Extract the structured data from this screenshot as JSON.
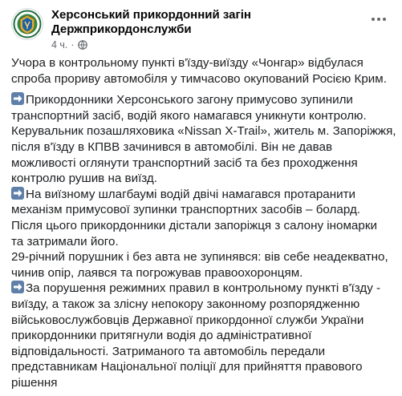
{
  "post": {
    "page_name_line1": "Херсонський прикордонний загін",
    "page_name_line2": "Держприкордонслужби",
    "time": "4 ч.",
    "separator": "·",
    "privacy_icon": "globe-icon",
    "more_icon": "more-options-icon",
    "paragraphs": [
      {
        "lines": [
          "Учора в контрольному пункті в'їзду-виїзду «Чонгар» відбулася",
          "спроба прориву автомобіля у тимчасово окупований Росією Крим."
        ]
      },
      {
        "lines": [
          "Прикордонники Херсонського загону примусово зупинили",
          "транспортний засіб, водій якого намагався уникнути контролю.",
          "Керувальник позашляховика «Nissan X-Trail», житель м. Запоріжжя,",
          "після в'їзду в КПВВ зачинився в автомобілі. Він не давав",
          "можливості оглянути транспортний засіб та без проходження",
          "контролю рушив на виїзд.",
          "На виїзному шлагбаумі водій двічі намагався протаранити",
          "механізм примусової зупинки транспортних засобів – болард.",
          "Після цього прикордонники дістали запоріжця з салону іномарки",
          "та затримали його.",
          "29-річний порушник і без авта не зупинявся: вів себе неадекватно,",
          "чинив опір, лаявся та погрожував правоохоронцям.",
          "За порушення режимних правил в контрольному пункті в'їзду -",
          "виїзду, а також за злісну непокору законному розпорядженню",
          "військовослужбовців Державної прикордонної служби України",
          "прикордонники притягнули водія до адміністративної",
          "відповідальності. Затриманого та автомобіль передали",
          "представникам Національної поліції для прийняття правового",
          "рішення"
        ],
        "arrow_lines": [
          0,
          6,
          12
        ]
      }
    ]
  }
}
